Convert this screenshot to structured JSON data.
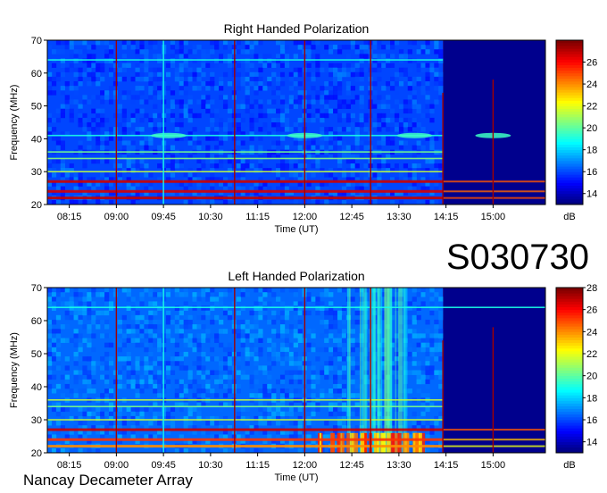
{
  "observation_id": "S030730",
  "observatory": "Nancay Decameter Array",
  "chart_data": [
    {
      "type": "heatmap",
      "title": "Right Handed Polarization",
      "xlabel": "Time (UT)",
      "ylabel": "Frequency (MHz)",
      "x_tick_labels": [
        "08:15",
        "09:00",
        "09:45",
        "10:30",
        "11:15",
        "12:00",
        "12:45",
        "13:30",
        "14:15",
        "15:00"
      ],
      "y_ticks": [
        20,
        30,
        40,
        50,
        60,
        70
      ],
      "ylim": [
        20,
        70
      ],
      "colorbar": {
        "label": "dB",
        "ticks": [
          14,
          16,
          18,
          20,
          22,
          24,
          26
        ],
        "range": [
          13,
          28
        ]
      },
      "vertical_bursts_UT": [
        "09:00",
        "09:45",
        "10:53",
        "12:00",
        "13:03",
        "14:12",
        "15:00"
      ],
      "horizontal_bands_MHz": [
        41,
        64,
        22,
        24,
        27,
        30,
        34,
        36
      ],
      "quiet_region_start_UT": "14:12"
    },
    {
      "type": "heatmap",
      "title": "Left Handed Polarization",
      "xlabel": "Time (UT)",
      "ylabel": "Frequency (MHz)",
      "x_tick_labels": [
        "08:15",
        "09:00",
        "09:45",
        "10:30",
        "11:15",
        "12:00",
        "12:45",
        "13:30",
        "14:15",
        "15:00"
      ],
      "y_ticks": [
        20,
        30,
        40,
        50,
        60,
        70
      ],
      "ylim": [
        20,
        70
      ],
      "colorbar": {
        "label": "dB",
        "ticks": [
          14,
          16,
          18,
          20,
          22,
          24,
          26,
          28
        ],
        "range": [
          13,
          28
        ]
      },
      "vertical_bursts_UT": [
        "09:00",
        "09:45",
        "10:53",
        "12:00",
        "13:03",
        "14:12",
        "15:00"
      ],
      "horizontal_bands_MHz": [
        64,
        22,
        24,
        27,
        30,
        34,
        36
      ],
      "quiet_region_start_UT": "14:12"
    }
  ]
}
